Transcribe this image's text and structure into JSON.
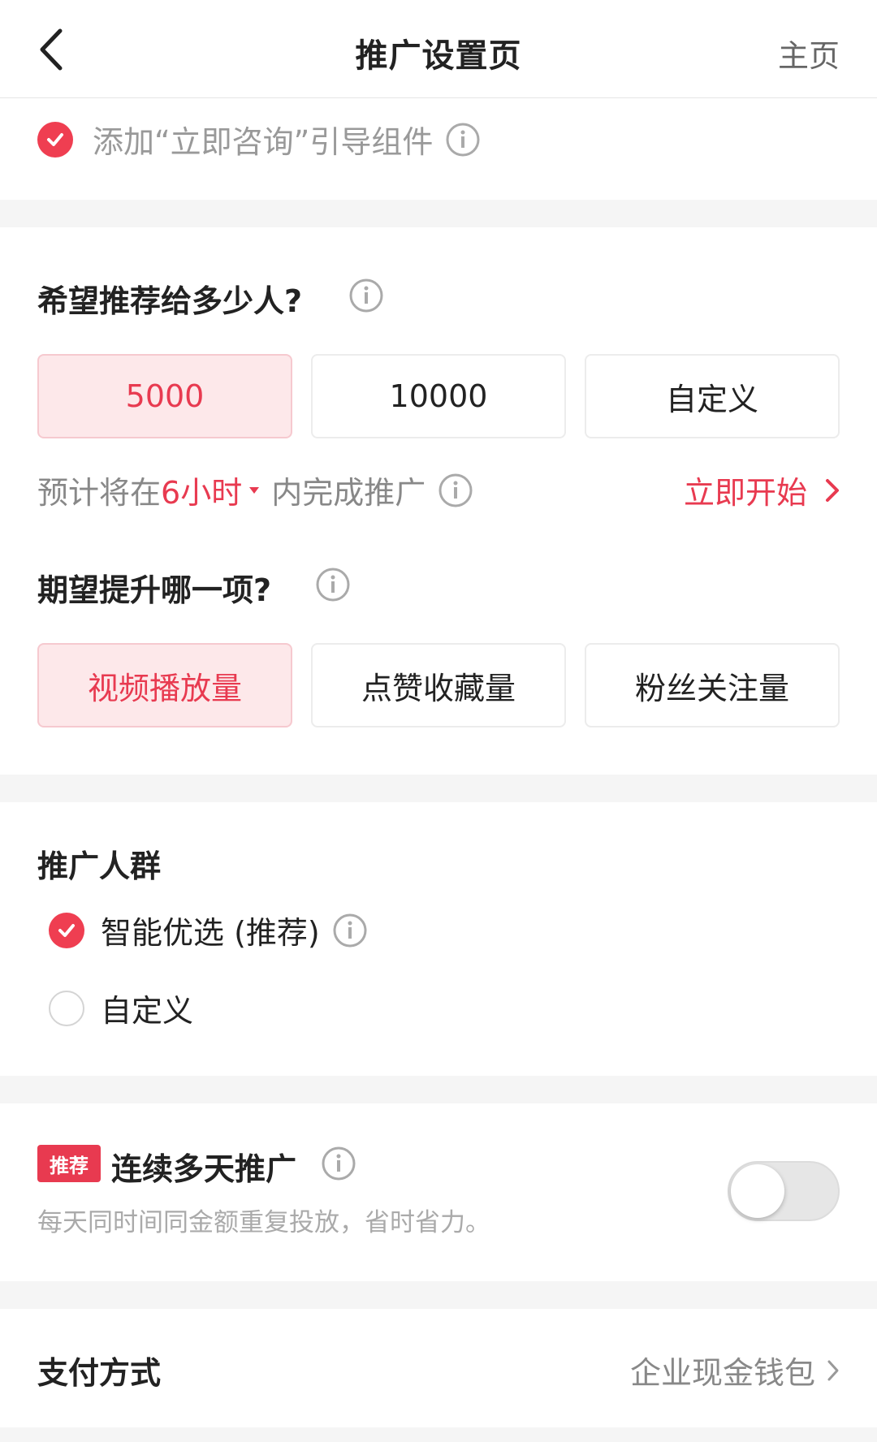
{
  "nav": {
    "title": "推广设置页",
    "home": "主页"
  },
  "consult": {
    "label": "添加“立即咨询”引导组件",
    "checked": true
  },
  "reach": {
    "title": "希望推荐给多少人?",
    "options": [
      "5000",
      "10000",
      "自定义"
    ],
    "selected": "5000",
    "estimate_prefix": "预计将在",
    "estimate_time": "6小时",
    "estimate_suffix": "内完成推广",
    "start_label": "立即开始"
  },
  "goal": {
    "title": "期望提升哪一项?",
    "options": [
      "视频播放量",
      "点赞收藏量",
      "粉丝关注量"
    ],
    "selected": "视频播放量"
  },
  "audience": {
    "title": "推广人群",
    "options": [
      {
        "label": "智能优选 (推荐)",
        "checked": true
      },
      {
        "label": "自定义",
        "checked": false
      }
    ]
  },
  "multiday": {
    "badge": "推荐",
    "title": "连续多天推广",
    "desc": "每天同时间同金额重复投放，省时省力。",
    "enabled": false
  },
  "payment": {
    "label": "支付方式",
    "value": "企业现金钱包"
  },
  "colors": {
    "accent": "#e83a50",
    "selected_bg": "#fde8ea",
    "separator": "#f5f5f5"
  }
}
